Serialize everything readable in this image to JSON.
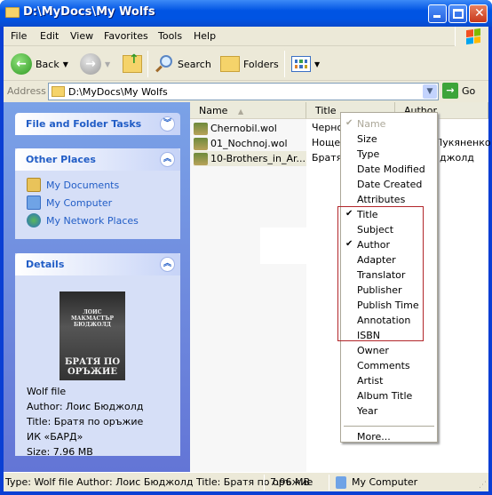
{
  "window": {
    "title": "D:\\MyDocs\\My Wolfs"
  },
  "menubar": {
    "items": [
      "File",
      "Edit",
      "View",
      "Favorites",
      "Tools",
      "Help"
    ]
  },
  "toolbar": {
    "back_label": "Back",
    "search_label": "Search",
    "folders_label": "Folders"
  },
  "address": {
    "label": "Address",
    "value": "D:\\MyDocs\\My Wolfs",
    "go_label": "Go"
  },
  "taskpane": {
    "file_tasks_title": "File and Folder Tasks",
    "other_places_title": "Other Places",
    "other_places": [
      "My Documents",
      "My Computer",
      "My Network Places"
    ],
    "details_title": "Details",
    "cover": {
      "top": "ЛОИС МАКМАСТЪР БЮДЖОЛД",
      "bottom": "БРАТЯ ПО ОРЪЖИЕ"
    },
    "details": [
      "Wolf file",
      "Author: Лоис Бюджолд",
      "Title: Братя по оръжие",
      "ИК «БАРД»",
      "Size: 7.96 MB"
    ]
  },
  "list": {
    "columns": [
      "Name",
      "Title",
      "Author"
    ],
    "rows": [
      {
        "name": "Chernobil.wol",
        "title": "Черно",
        "author": ""
      },
      {
        "name": "01_Nochnoj.wol",
        "title": "Нощен",
        "author": "Лукяненко"
      },
      {
        "name": "10-Brothers_in_Ar...",
        "title": "Братя",
        "author": "джолд"
      }
    ]
  },
  "context_menu": {
    "items": [
      {
        "label": "Name",
        "checked": true,
        "disabled": true
      },
      {
        "label": "Size"
      },
      {
        "label": "Type"
      },
      {
        "label": "Date Modified"
      },
      {
        "label": "Date Created"
      },
      {
        "label": "Attributes"
      },
      {
        "label": "Title",
        "checked": true
      },
      {
        "label": "Subject"
      },
      {
        "label": "Author",
        "checked": true
      },
      {
        "label": "Adapter"
      },
      {
        "label": "Translator"
      },
      {
        "label": "Publisher"
      },
      {
        "label": "Publish Time"
      },
      {
        "label": "Annotation"
      },
      {
        "label": "ISBN"
      },
      {
        "label": "Owner"
      },
      {
        "label": "Comments"
      },
      {
        "label": "Artist"
      },
      {
        "label": "Album Title"
      },
      {
        "label": "Year"
      }
    ],
    "more_label": "More..."
  },
  "statusbar": {
    "info": "Type: Wolf file Author: Лоис Бюджолд Title: Братя по оръжие",
    "size": "7.96 MB",
    "zone": "My Computer"
  }
}
